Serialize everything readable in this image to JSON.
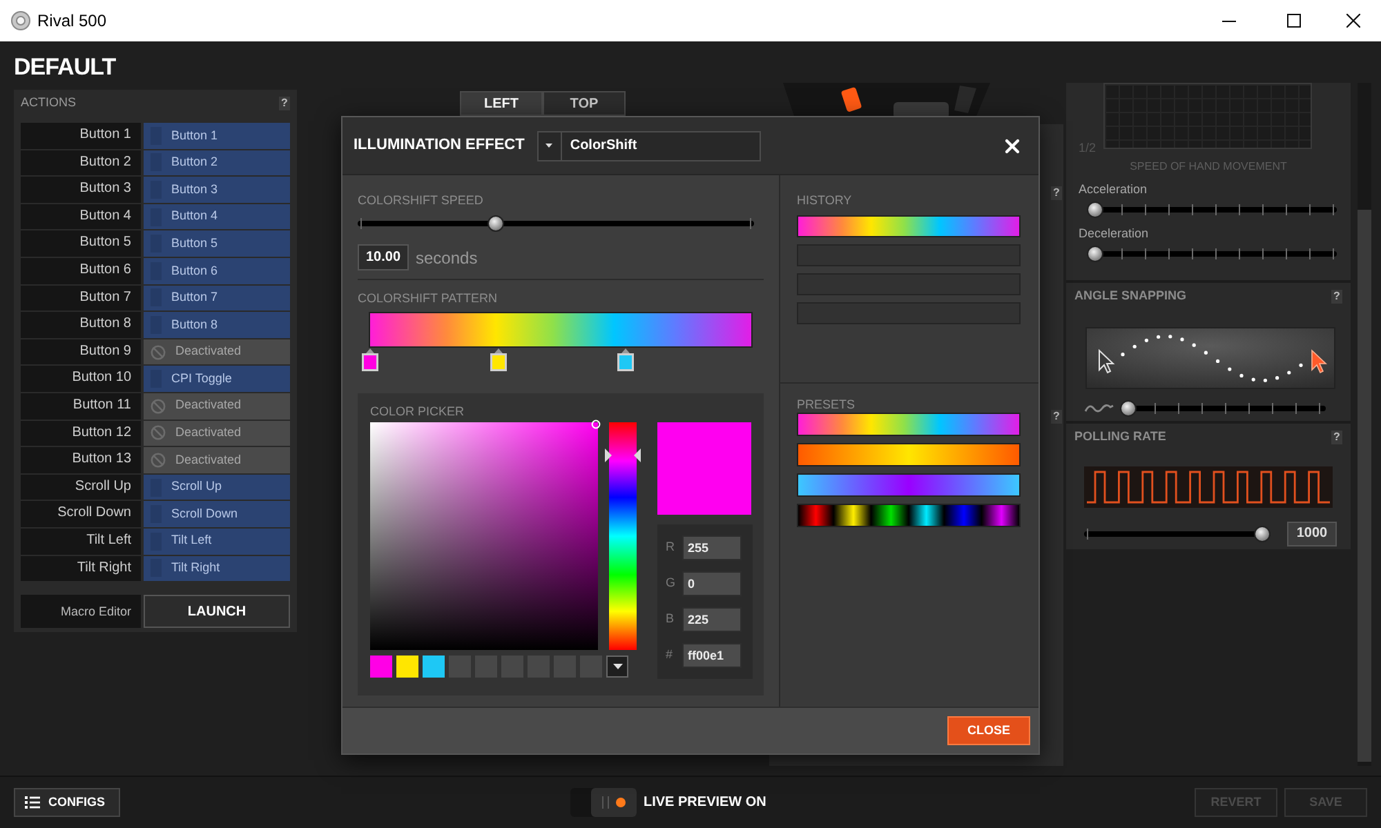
{
  "window": {
    "title": "Rival 500"
  },
  "profile": {
    "title": "DEFAULT"
  },
  "actions": {
    "title": "ACTIONS",
    "help": "?",
    "rows": [
      {
        "button": "Button 1",
        "action": "Button 1",
        "kind": "assigned"
      },
      {
        "button": "Button 2",
        "action": "Button 2",
        "kind": "assigned"
      },
      {
        "button": "Button 3",
        "action": "Button 3",
        "kind": "assigned"
      },
      {
        "button": "Button 4",
        "action": "Button 4",
        "kind": "assigned"
      },
      {
        "button": "Button 5",
        "action": "Button 5",
        "kind": "assigned"
      },
      {
        "button": "Button 6",
        "action": "Button 6",
        "kind": "assigned"
      },
      {
        "button": "Button 7",
        "action": "Button 7",
        "kind": "assigned"
      },
      {
        "button": "Button 8",
        "action": "Button 8",
        "kind": "assigned"
      },
      {
        "button": "Button 9",
        "action": "Deactivated",
        "kind": "deactivated"
      },
      {
        "button": "Button 10",
        "action": "CPI Toggle",
        "kind": "assigned"
      },
      {
        "button": "Button 11",
        "action": "Deactivated",
        "kind": "deactivated"
      },
      {
        "button": "Button 12",
        "action": "Deactivated",
        "kind": "deactivated"
      },
      {
        "button": "Button 13",
        "action": "Deactivated",
        "kind": "deactivated"
      },
      {
        "button": "Scroll Up",
        "action": "Scroll Up",
        "kind": "assigned"
      },
      {
        "button": "Scroll Down",
        "action": "Scroll Down",
        "kind": "assigned"
      },
      {
        "button": "Tilt Left",
        "action": "Tilt Left",
        "kind": "assigned"
      },
      {
        "button": "Tilt Right",
        "action": "Tilt Right",
        "kind": "assigned"
      }
    ],
    "macro_editor": {
      "label": "Macro Editor",
      "button": "LAUNCH"
    }
  },
  "view_tabs": [
    {
      "label": "LEFT",
      "selected": true
    },
    {
      "label": "TOP",
      "selected": false
    }
  ],
  "illumination_dialog": {
    "title": "ILLUMINATION EFFECT",
    "effect": {
      "value": "ColorShift"
    },
    "speed": {
      "label": "COLORSHIFT SPEED",
      "level": 0.34,
      "value": "10.00",
      "unit": "seconds"
    },
    "pattern": {
      "label": "COLORSHIFT PATTERN",
      "stops": [
        {
          "color": "#ff00e1"
        },
        {
          "color": "#ffe600"
        },
        {
          "color": "#1ec8f5"
        }
      ]
    },
    "color_picker": {
      "label": "COLOR PICKER",
      "hue": {
        "level": 0.855
      },
      "preview": {
        "color": "#ff00f0"
      },
      "channels": [
        {
          "label": "R",
          "value": "255"
        },
        {
          "label": "G",
          "value": "0"
        },
        {
          "label": "B",
          "value": "225"
        },
        {
          "label": "#",
          "value": "ff00e1"
        }
      ],
      "swatches": [
        {
          "kind": "color",
          "color": "#ff00e6"
        },
        {
          "kind": "color",
          "color": "#ffe600"
        },
        {
          "kind": "color",
          "color": "#1ec8f5"
        },
        {
          "kind": "empty"
        },
        {
          "kind": "empty"
        },
        {
          "kind": "empty"
        },
        {
          "kind": "empty"
        },
        {
          "kind": "empty"
        },
        {
          "kind": "empty"
        }
      ]
    },
    "history": {
      "label": "HISTORY",
      "slots": [
        {
          "kind": "spectrum"
        },
        {
          "kind": "empty"
        },
        {
          "kind": "empty"
        },
        {
          "kind": "empty"
        }
      ]
    },
    "presets": {
      "label": "PRESETS",
      "items": [
        {
          "kind": "spectrum"
        },
        {
          "kind": "sunset"
        },
        {
          "kind": "violet"
        },
        {
          "kind": "segments"
        }
      ]
    },
    "close_button": "CLOSE"
  },
  "side_help": [
    "?",
    "?"
  ],
  "sensitivity": {
    "page": "1/2",
    "axis_label": "SPEED OF HAND MOVEMENT",
    "sliders": [
      {
        "label": "Acceleration",
        "level": 0
      },
      {
        "label": "Deceleration",
        "level": 0
      }
    ]
  },
  "angle_snapping": {
    "title": "ANGLE SNAPPING",
    "help": "?",
    "level": 0
  },
  "polling_rate": {
    "title": "POLLING RATE",
    "help": "?",
    "level": 1,
    "value": "1000"
  },
  "bottom_bar": {
    "configs_button": "CONFIGS",
    "live_preview": {
      "label": "LIVE PREVIEW ON",
      "on": true
    },
    "buttons": [
      {
        "label": "REVERT",
        "disabled": true
      },
      {
        "label": "SAVE",
        "disabled": true
      }
    ]
  }
}
